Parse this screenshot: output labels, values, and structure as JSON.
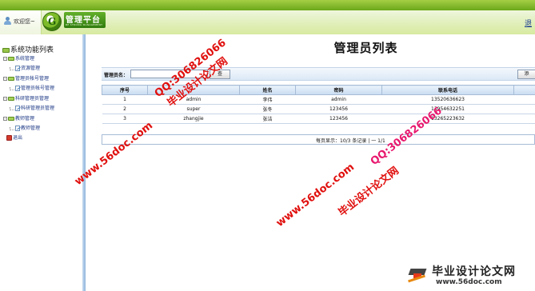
{
  "header": {
    "welcome": "欢迎您~",
    "logo_title": "管理平台",
    "logo_subtitle": "BE STRONG MANAGEMENT",
    "logout_label": "退"
  },
  "sidebar": {
    "title": "系统功能列表",
    "nodes": [
      {
        "label": "系统管理",
        "children": [
          "资源管理"
        ]
      },
      {
        "label": "管理员帐号管理",
        "children": [
          "管理员帐号管理"
        ]
      },
      {
        "label": "科研管理员管理",
        "children": [
          "科研管理员管理"
        ]
      },
      {
        "label": "教师管理",
        "children": [
          "教师管理"
        ]
      }
    ],
    "exit_label": "退出"
  },
  "main": {
    "title": "管理员列表",
    "search_label": "管理员名：",
    "search_value": "",
    "search_button": "查",
    "add_button": "添",
    "columns": [
      "序号",
      "",
      "姓名",
      "密码",
      "联系电话",
      ""
    ],
    "rows": [
      [
        "1",
        "admin",
        "李伟",
        "admin",
        "13520636623"
      ],
      [
        "2",
        "super",
        "张冬",
        "123456",
        "13954632251"
      ],
      [
        "3",
        "zhangjie",
        "张洁",
        "123456",
        "13265223632"
      ]
    ],
    "pager": "每页显示：10/3 条记录 | 一  1/1"
  },
  "watermarks": {
    "qq": "QQ:306826066",
    "site_cn": "毕业设计论文网",
    "url": "www.56doc.com"
  },
  "brand": {
    "title": "毕业设计论文网",
    "url": "www.56doc.com"
  }
}
